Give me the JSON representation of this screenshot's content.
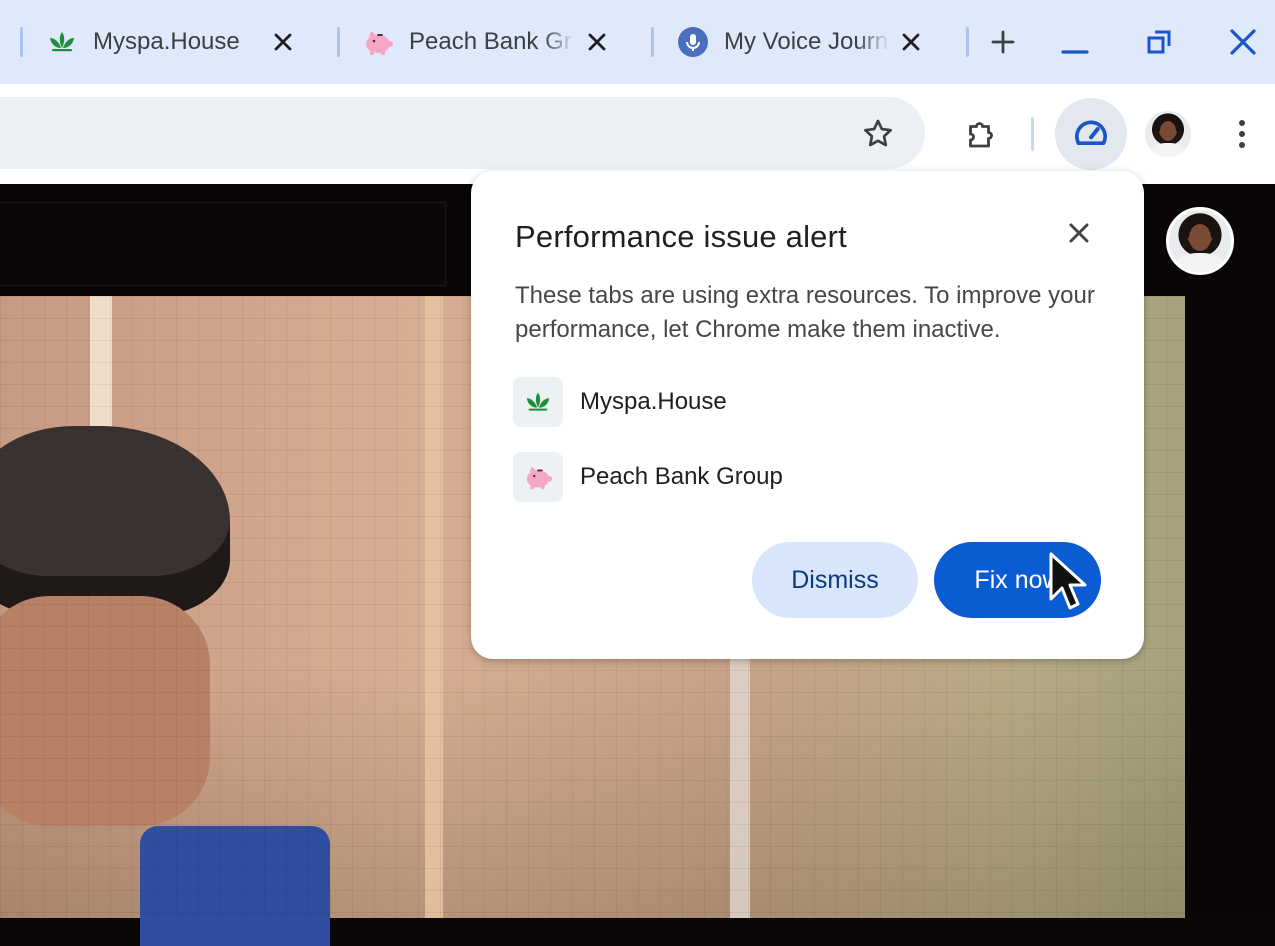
{
  "tabs": [
    {
      "title": "Myspa.House",
      "icon": "leaf-icon"
    },
    {
      "title": "Peach Bank Gr",
      "icon": "piggy-bank-icon"
    },
    {
      "title": "My Voice Journ",
      "icon": "microphone-icon"
    }
  ],
  "toolbar": {
    "bookmark_icon": "star-icon",
    "extensions_icon": "puzzle-icon",
    "performance_icon": "speedometer-icon",
    "menu_icon": "kebab-menu-icon"
  },
  "popup": {
    "title": "Performance issue alert",
    "description": "These tabs are using extra resources. To improve your performance, let Chrome make them inactive.",
    "sites": [
      {
        "name": "Myspa.House",
        "icon": "leaf-icon"
      },
      {
        "name": "Peach Bank Group",
        "icon": "piggy-bank-icon"
      }
    ],
    "dismiss_label": "Dismiss",
    "fix_label": "Fix now"
  },
  "colors": {
    "tabstrip": "#dfe9fb",
    "accent": "#0b5bd3",
    "dismiss_bg": "#d8e5fb",
    "leaf": "#1e8e3e",
    "piggy": "#f6a6c5"
  }
}
